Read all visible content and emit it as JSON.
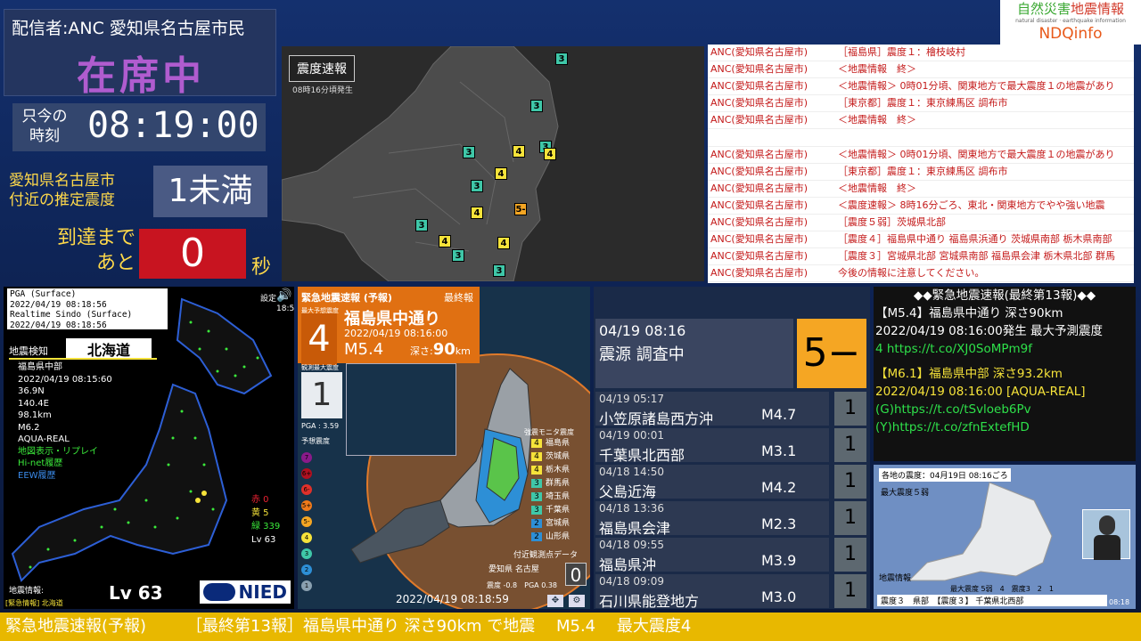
{
  "distributor": "配信者:ANC 愛知県名古屋市民",
  "status": "在席中",
  "clock": {
    "label": "只今の\n時刻",
    "time": "08:19:00"
  },
  "intensity_est": {
    "label": "愛知県名古屋市\n付近の推定震度",
    "value": "1未満"
  },
  "arrival": {
    "label": "到達まで\nあと",
    "count": "0",
    "unit": "秒"
  },
  "logo": {
    "line1a": "自然災害",
    "line1b": "地震情報",
    "sub": "natural disaster · earthquake information",
    "brand": "NDQinfo"
  },
  "topmap": {
    "title": "震度速報",
    "time": "08時16分頃発生"
  },
  "log": [
    {
      "src": "ANC(愛知県名古屋市)",
      "msg": "［福島県］震度１：檜枝岐村"
    },
    {
      "src": "ANC(愛知県名古屋市)",
      "msg": "＜地震情報　終＞"
    },
    {
      "src": "ANC(愛知県名古屋市)",
      "msg": "＜地震情報＞ 0時01分頃、関東地方で最大震度１の地震があり"
    },
    {
      "src": "ANC(愛知県名古屋市)",
      "msg": "［東京都］震度１：東京練馬区 調布市"
    },
    {
      "src": "ANC(愛知県名古屋市)",
      "msg": "＜地震情報　終＞"
    },
    {
      "src": "",
      "msg": ""
    },
    {
      "src": "ANC(愛知県名古屋市)",
      "msg": "＜地震情報＞ 0時01分頃、関東地方で最大震度１の地震があり"
    },
    {
      "src": "ANC(愛知県名古屋市)",
      "msg": "［東京都］震度１：東京練馬区 調布市"
    },
    {
      "src": "ANC(愛知県名古屋市)",
      "msg": "＜地震情報　終＞"
    },
    {
      "src": "ANC(愛知県名古屋市)",
      "msg": "＜震度速報＞ 8時16分ごろ、東北・関東地方でやや強い地震"
    },
    {
      "src": "ANC(愛知県名古屋市)",
      "msg": "［震度５弱］茨城県北部"
    },
    {
      "src": "ANC(愛知県名古屋市)",
      "msg": "［震度４］福島県中通り 福島県浜通り 茨城県南部 栃木県南部"
    },
    {
      "src": "ANC(愛知県名古屋市)",
      "msg": "［震度３］宮城県北部 宮城県南部 福島県会津 栃木県北部 群馬"
    },
    {
      "src": "ANC(愛知県名古屋市)",
      "msg": "今後の情報に注意してください。"
    }
  ],
  "kyoshin": {
    "box": [
      "PGA (Surface)",
      "2022/04/19 08:18:56",
      "Realtime Sindo (Surface)",
      "2022/04/19 08:18:56"
    ],
    "detect_label": "地震検知",
    "region": "北海道",
    "info": [
      "福島県中部",
      "2022/04/19 08:15:60",
      "36.9N",
      "140.4E",
      "98.1km",
      "M6.2",
      "AQUA-REAL"
    ],
    "links": [
      "地図表示・リプレイ",
      "Hi-net履歴",
      "EEW履歴"
    ],
    "counts": [
      "赤 0",
      "黄 5",
      "緑 339",
      "Lv 63"
    ],
    "level": "Lv 63",
    "brand": "NIED",
    "footer": "地震情報:",
    "footer2": "[緊急情報] 北海道",
    "settings": "設定",
    "sound_time": "18:5"
  },
  "eew": {
    "title": "緊急地震速報 (予報)",
    "final": "最終報",
    "max_label": "最大予想震度",
    "shindo": "4",
    "epicenter": "福島県中通り",
    "time": "2022/04/19 08:16:00",
    "mag": "M5.4",
    "depth_label": "深さ:",
    "depth": "90",
    "depth_unit": "km",
    "observed_label": "観測最大震度",
    "observed": "1",
    "pga": "PGA : 3.59",
    "legend_title": "予想震度",
    "legend": [
      "7",
      "6+",
      "6-",
      "5+",
      "5-",
      "4",
      "3",
      "2",
      "1"
    ],
    "monitor_title": "強震モニタ震度",
    "monitor": [
      {
        "s": "4",
        "p": "福島県"
      },
      {
        "s": "4",
        "p": "茨城県"
      },
      {
        "s": "4",
        "p": "栃木県"
      },
      {
        "s": "3",
        "p": "群馬県"
      },
      {
        "s": "3",
        "p": "埼玉県"
      },
      {
        "s": "3",
        "p": "千葉県"
      },
      {
        "s": "2",
        "p": "宮城県"
      },
      {
        "s": "2",
        "p": "山形県"
      }
    ],
    "nearby_title": "付近観測点データ",
    "nearby_loc": "愛知県 名古屋",
    "nearby_val": "0",
    "nearby_vals": "震度 -0.8　PGA 0.38",
    "timestamp": "2022/04/19 08:18:59"
  },
  "history": {
    "latest": {
      "date": "04/19 08:16",
      "place": "震源 調査中",
      "shindo": "5−"
    },
    "items": [
      {
        "date": "04/19 05:17",
        "place": "小笠原諸島西方沖",
        "mag": "M4.7",
        "s": "1"
      },
      {
        "date": "04/19 00:01",
        "place": "千葉県北西部",
        "mag": "M3.1",
        "s": "1"
      },
      {
        "date": "04/18 14:50",
        "place": "父島近海",
        "mag": "M4.2",
        "s": "1"
      },
      {
        "date": "04/18 13:36",
        "place": "福島県会津",
        "mag": "M2.3",
        "s": "1"
      },
      {
        "date": "04/18 09:55",
        "place": "福島県沖",
        "mag": "M3.9",
        "s": "1"
      },
      {
        "date": "04/18 09:09",
        "place": "石川県能登地方",
        "mag": "M3.0",
        "s": "1"
      }
    ]
  },
  "twitter": {
    "lines": [
      "◆◆緊急地震速報(最終第13報)◆◆",
      "【M5.4】福島県中通り 深さ90km",
      "2022/04/19 08:16:00発生 最大予測震度",
      "4 https://t.co/XJ0SoMPm9f",
      "",
      "【M6.1】福島県中部 深さ93.2km",
      "2022/04/19 08:16:00 [AQUA-REAL]",
      "(G)https://t.co/tSvloeb6Pv",
      "(Y)https://t.co/zfnExtefHD"
    ]
  },
  "tv": {
    "header": "各地の震度：04月19日 08:16ごろ",
    "max": "最大震度５弱",
    "caption": "地震情報",
    "legend": "最大震度 5弱　4　震度3　2　1",
    "bottom": "震度３　県部　【震度３】 千葉県北西部",
    "clock": "08:18"
  },
  "ticker": "緊急地震速報(予報)　　　［最終第13報］福島県中通り 深さ90km で地震　 M5.4　 最大震度4",
  "colors": {
    "shindo4": "#f6e33a",
    "shindo3": "#3fc7a8",
    "shindo5": "#f5a623",
    "accent_red": "#c81420",
    "ticker": "#e8b800"
  }
}
